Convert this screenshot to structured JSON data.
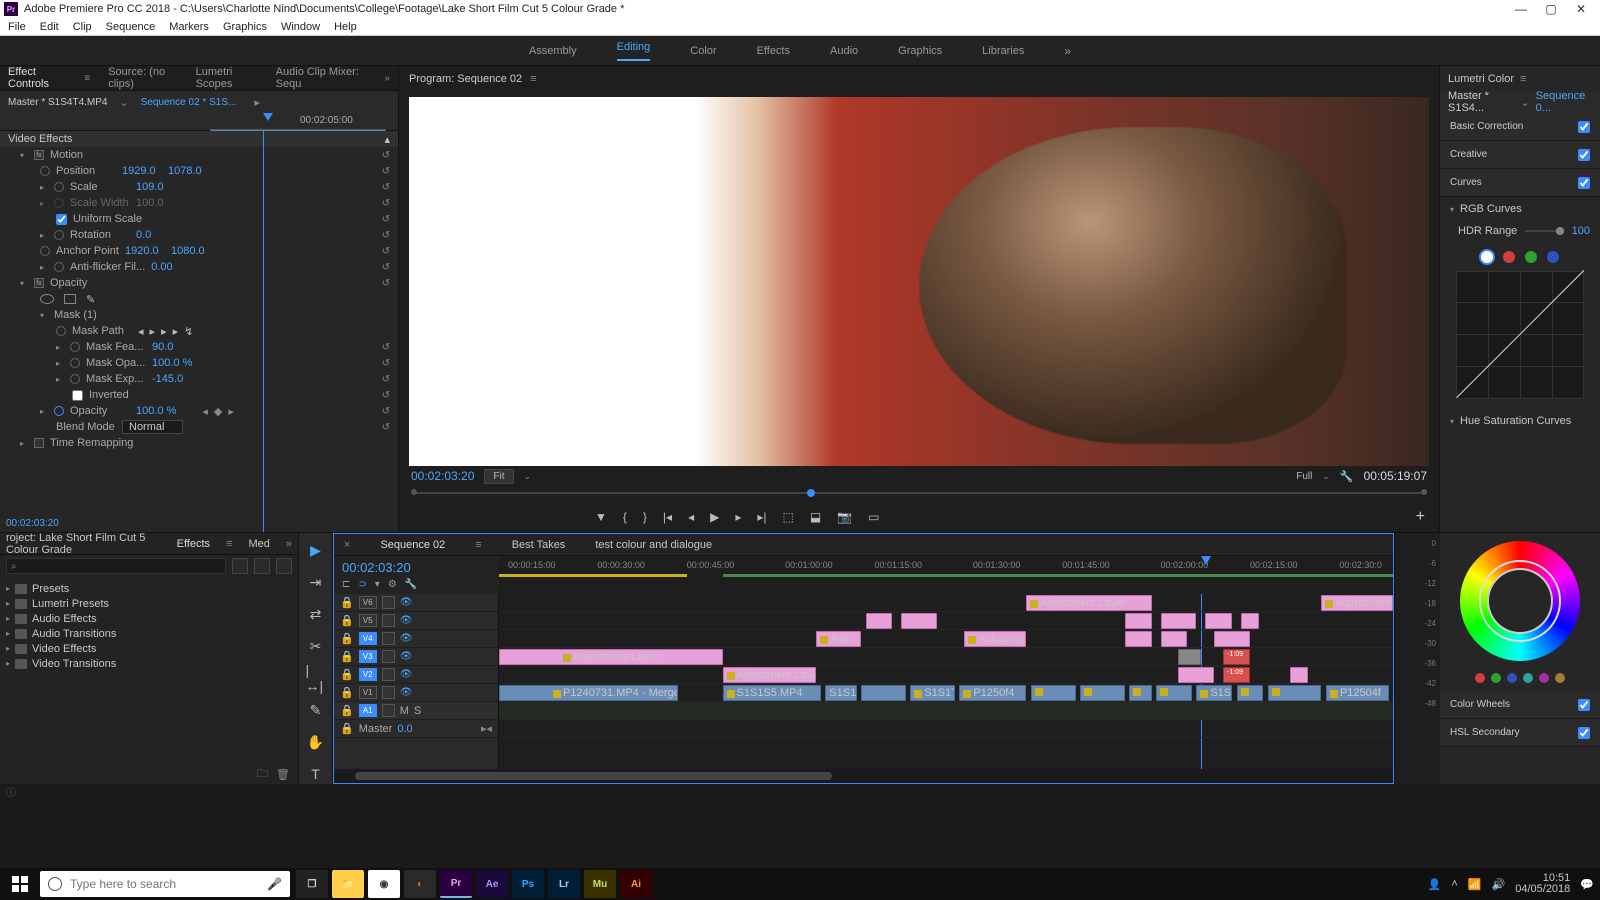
{
  "titlebar": {
    "app_badge": "Pr",
    "title": "Adobe Premiere Pro CC 2018 - C:\\Users\\Charlotte Nind\\Documents\\College\\Footage\\Lake Short Film Cut 5 Colour Grade *"
  },
  "menu": [
    "File",
    "Edit",
    "Clip",
    "Sequence",
    "Markers",
    "Graphics",
    "Window",
    "Help"
  ],
  "workspaces": {
    "items": [
      "Assembly",
      "Editing",
      "Color",
      "Effects",
      "Audio",
      "Graphics",
      "Libraries"
    ],
    "active": "Editing"
  },
  "effect_controls": {
    "tabs": [
      "Effect Controls",
      "Source: (no clips)",
      "Lumetri Scopes",
      "Audio Clip Mixer: Sequ"
    ],
    "active_tab": "Effect Controls",
    "master": "Master * S1S4T4.MP4",
    "sequence": "Sequence 02 * S1S...",
    "ruler_tc": "00:02:05:00",
    "clip_label": "S1S4T4.MP4",
    "video_effects": "Video Effects",
    "motion": {
      "label": "Motion",
      "position": {
        "label": "Position",
        "x": "1929.0",
        "y": "1078.0"
      },
      "scale": {
        "label": "Scale",
        "v": "109.0"
      },
      "scale_width": {
        "label": "Scale Width",
        "v": "100.0"
      },
      "uniform": {
        "label": "Uniform Scale",
        "checked": true
      },
      "rotation": {
        "label": "Rotation",
        "v": "0.0"
      },
      "anchor": {
        "label": "Anchor Point",
        "x": "1920.0",
        "y": "1080.0"
      },
      "antiflicker": {
        "label": "Anti-flicker Fil...",
        "v": "0.00"
      }
    },
    "opacity": {
      "label": "Opacity",
      "mask": {
        "label": "Mask (1)",
        "path": "Mask Path",
        "feather": {
          "label": "Mask Fea...",
          "v": "90.0"
        },
        "opacity": {
          "label": "Mask Opa...",
          "v": "100.0 %"
        },
        "expansion": {
          "label": "Mask Exp...",
          "v": "-145.0"
        },
        "inverted": {
          "label": "Inverted",
          "checked": false
        }
      },
      "value": {
        "label": "Opacity",
        "v": "100.0 %"
      },
      "blend": {
        "label": "Blend Mode",
        "v": "Normal"
      }
    },
    "time_remap": "Time Remapping",
    "timecode": "00:02:03:20"
  },
  "program": {
    "tab": "Program: Sequence 02",
    "tc": "00:02:03:20",
    "fit": "Fit",
    "full": "Full",
    "duration": "00:05:19:07",
    "transport_icons": [
      "add-marker-icon",
      "mark-in-icon",
      "mark-out-icon",
      "go-in-icon",
      "step-back-icon",
      "play-icon",
      "step-fwd-icon",
      "go-out-icon",
      "lift-icon",
      "extract-icon",
      "export-frame-icon",
      "comparison-icon"
    ]
  },
  "lumetri": {
    "tab": "Lumetri Color",
    "master": "Master * S1S4...",
    "sequence": "Sequence 0...",
    "sections": {
      "basic": {
        "label": "Basic Correction",
        "on": true
      },
      "creative": {
        "label": "Creative",
        "on": true
      },
      "curves": {
        "label": "Curves",
        "on": true
      },
      "rgb": {
        "label": "RGB Curves"
      },
      "hdr": {
        "label": "HDR Range",
        "v": "100"
      },
      "huesat": {
        "label": "Hue Saturation Curves"
      },
      "wheels": {
        "label": "Color Wheels",
        "on": true
      },
      "hsl": {
        "label": "HSL Secondary",
        "on": true
      }
    },
    "rgb_dots": [
      "#ffffff",
      "#d04040",
      "#30a030",
      "#3050c0"
    ],
    "palette": [
      "#d04040",
      "#30a030",
      "#3050c0",
      "#30a0a0",
      "#a030a0",
      "#a08030"
    ]
  },
  "project": {
    "tabs": [
      "roject: Lake Short Film Cut 5 Colour Grade",
      "Effects",
      "Med"
    ],
    "active": "Effects",
    "search_icon": "⌕",
    "tree": [
      "Presets",
      "Lumetri Presets",
      "Audio Effects",
      "Audio Transitions",
      "Video Effects",
      "Video Transitions"
    ]
  },
  "tools": [
    "selection-icon",
    "track-select-icon",
    "ripple-edit-icon",
    "razor-icon",
    "slip-icon",
    "pen-icon",
    "hand-icon",
    "type-icon"
  ],
  "timeline": {
    "tabs": [
      "Sequence 02",
      "Best Takes",
      "test colour and dialogue"
    ],
    "active": "Sequence 02",
    "tc": "00:02:03:20",
    "head_icons": [
      "snap-icon",
      "linked-sel-icon",
      "marker-icon",
      "settings-icon",
      "wrench-icon"
    ],
    "ruler": [
      "00:00:15:00",
      "00:00:30:00",
      "00:00:45:00",
      "00:01:00:00",
      "00:01:15:00",
      "00:01:30:00",
      "00:01:45:00",
      "00:02:00:00",
      "00:02:15:00",
      "00:02:30:0"
    ],
    "tracks": {
      "v6": "V6",
      "v5": "V5",
      "v4": "V4",
      "v3": "V3",
      "v2": "V2",
      "v1": "V1",
      "a1": "A1",
      "master": "Master",
      "master_v": "0.0",
      "ms": [
        "M",
        "S"
      ]
    },
    "clips": {
      "adj_v6": "Adjustment Layer",
      "adj_v6b": "Adjustment La",
      "adj_v4a": "Adju",
      "adj_v4b": "Adjustme",
      "adj_v3": "Adjustment Layer",
      "adj_v2": "Adjustment Laye",
      "v1a": "P1240731.MP4 - Merged",
      "v1b": "S1S1S5.MP4",
      "v1c": "S1S1",
      "v1d": "S1S1T3.M",
      "v1e": "P1250f4",
      "v1f": "S1S4",
      "v1g": "P12504f",
      "red": "-1:09"
    }
  },
  "meters": {
    "ticks": [
      "0",
      "-6",
      "-12",
      "-18",
      "-24",
      "-30",
      "-36",
      "-42",
      "-48"
    ]
  },
  "taskbar": {
    "search_placeholder": "Type here to search",
    "apps": [
      {
        "name": "task-view-icon",
        "bg": "#222",
        "fg": "#ccc",
        "txt": "❐"
      },
      {
        "name": "explorer-icon",
        "bg": "#ffcf4b",
        "fg": "#7a5b10",
        "txt": "📁"
      },
      {
        "name": "chrome-icon",
        "bg": "#fff",
        "fg": "#333",
        "txt": "◉"
      },
      {
        "name": "resolve-icon",
        "bg": "#2a2a2a",
        "fg": "#e07030",
        "txt": "◐"
      },
      {
        "name": "premiere-icon",
        "bg": "#2a0040",
        "fg": "#e6a0ff",
        "txt": "Pr"
      },
      {
        "name": "aftereffects-icon",
        "bg": "#1a0a3a",
        "fg": "#b090ff",
        "txt": "Ae"
      },
      {
        "name": "photoshop-icon",
        "bg": "#001e36",
        "fg": "#31a8ff",
        "txt": "Ps"
      },
      {
        "name": "lightroom-icon",
        "bg": "#001e36",
        "fg": "#aed0e0",
        "txt": "Lr"
      },
      {
        "name": "muse-icon",
        "bg": "#3a3000",
        "fg": "#c8e060",
        "txt": "Mu"
      },
      {
        "name": "illustrator-icon",
        "bg": "#330000",
        "fg": "#ff9a00",
        "txt": "Ai"
      }
    ],
    "clock": {
      "time": "10:51",
      "date": "04/05/2018"
    }
  }
}
